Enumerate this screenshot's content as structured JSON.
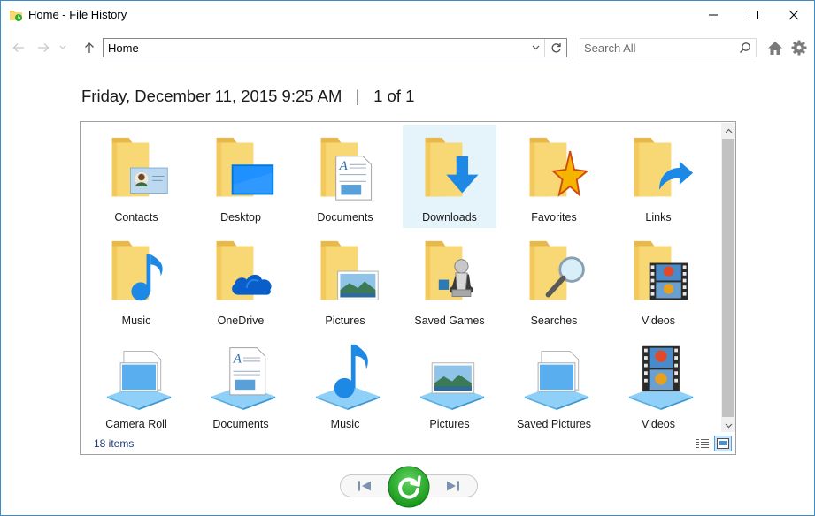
{
  "window": {
    "title": "Home - File History",
    "app_icon": "file-history-icon",
    "controls": [
      "minimize-icon",
      "maximize-icon",
      "close-icon"
    ]
  },
  "toolbar": {
    "back_icon": "back-arrow-icon",
    "forward_icon": "forward-arrow-icon",
    "recent_icon": "chevron-down-icon",
    "up_icon": "up-arrow-icon",
    "address_value": "Home",
    "search_placeholder": "Search All",
    "home_icon": "home-icon",
    "settings_icon": "gear-icon"
  },
  "heading": {
    "date": "Friday, December 11, 2015 9:25 AM",
    "separator": "|",
    "page": "1 of 1"
  },
  "items": [
    {
      "label": "Contacts",
      "icon": "contacts-folder-icon"
    },
    {
      "label": "Desktop",
      "icon": "desktop-folder-icon"
    },
    {
      "label": "Documents",
      "icon": "documents-folder-icon"
    },
    {
      "label": "Downloads",
      "icon": "downloads-folder-icon",
      "selected": true
    },
    {
      "label": "Favorites",
      "icon": "favorites-folder-icon"
    },
    {
      "label": "Links",
      "icon": "links-folder-icon"
    },
    {
      "label": "Music",
      "icon": "music-folder-icon"
    },
    {
      "label": "OneDrive",
      "icon": "onedrive-folder-icon"
    },
    {
      "label": "Pictures",
      "icon": "pictures-folder-icon"
    },
    {
      "label": "Saved Games",
      "icon": "saved-games-folder-icon"
    },
    {
      "label": "Searches",
      "icon": "searches-folder-icon"
    },
    {
      "label": "Videos",
      "icon": "videos-folder-icon"
    },
    {
      "label": "Camera Roll",
      "icon": "camera-roll-library-icon"
    },
    {
      "label": "Documents",
      "icon": "documents-library-icon"
    },
    {
      "label": "Music",
      "icon": "music-library-icon"
    },
    {
      "label": "Pictures",
      "icon": "pictures-library-icon"
    },
    {
      "label": "Saved Pictures",
      "icon": "saved-pictures-library-icon"
    },
    {
      "label": "Videos",
      "icon": "videos-library-icon"
    }
  ],
  "status": {
    "items_count": "18 items",
    "view_modes": [
      "details-view-icon",
      "large-icons-view-icon"
    ],
    "active_view": "large-icons-view-icon"
  },
  "playback": {
    "previous_icon": "previous-version-icon",
    "restore_icon": "restore-icon",
    "next_icon": "next-version-icon"
  },
  "colors": {
    "folder": "#f8d775",
    "folder_back": "#e8b84a",
    "accent_blue": "#1e90e8",
    "restore_green": "#2cad2c",
    "selection": "#e5f3fb",
    "window_border": "#3c8cc8"
  }
}
